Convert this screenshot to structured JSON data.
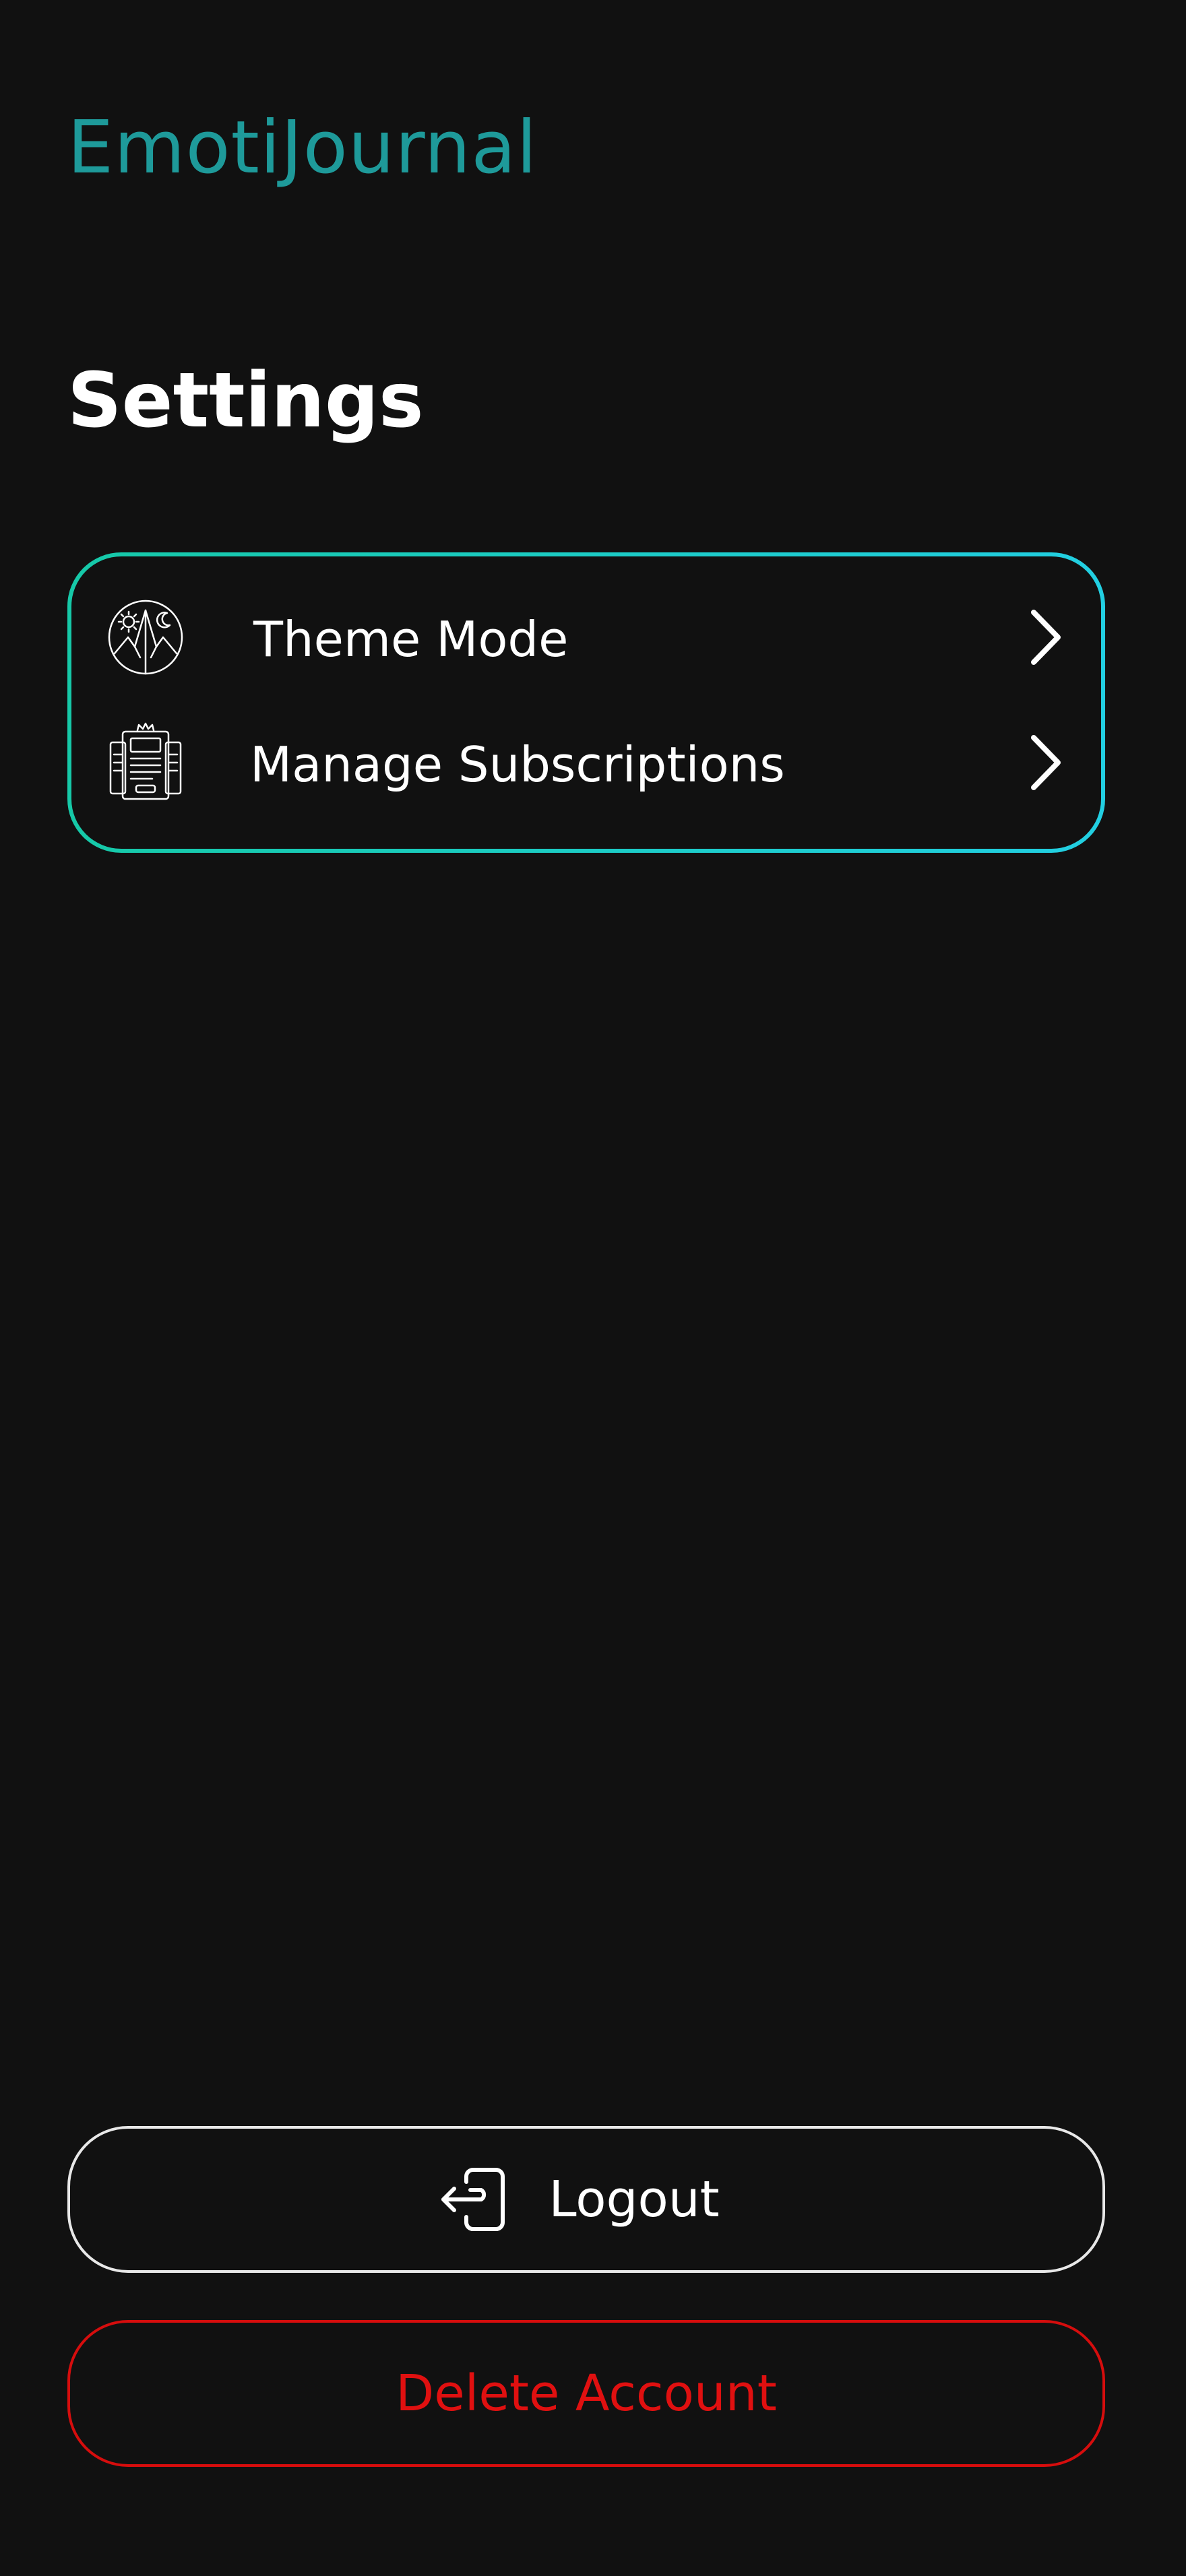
{
  "app": {
    "title": "EmotiJournal"
  },
  "page": {
    "title": "Settings"
  },
  "settings": {
    "items": [
      {
        "label": "Theme Mode",
        "icon": "theme-mode-icon"
      },
      {
        "label": "Manage Subscriptions",
        "icon": "subscriptions-icon"
      }
    ],
    "chevron_icon": "chevron-right-icon"
  },
  "actions": {
    "logout_label": "Logout",
    "logout_icon": "logout-icon",
    "delete_label": "Delete Account"
  },
  "colors": {
    "background": "#111111",
    "brand_title": "#1e9a9a",
    "card_border_start": "#16c9a8",
    "card_border_end": "#22cfe2",
    "text": "#ffffff",
    "danger": "#e01010"
  }
}
